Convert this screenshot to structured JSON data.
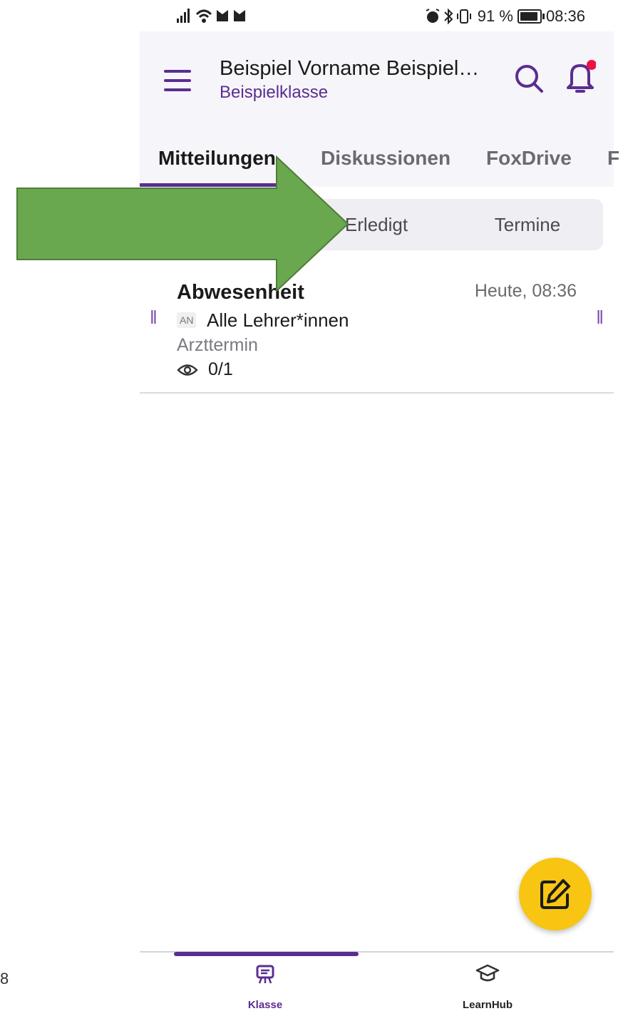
{
  "status_bar": {
    "left_icons": "signal wifi notification-icons",
    "battery_text": "91 %",
    "battery_level_percent": 91,
    "time": "08:36"
  },
  "header": {
    "title": "Beispiel Vorname Beispiel…",
    "subtitle": "Beispielklasse"
  },
  "tabs": [
    {
      "label": "Mitteilungen",
      "active": true
    },
    {
      "label": "Diskussionen",
      "active": false
    },
    {
      "label": "FoxDrive",
      "active": false
    },
    {
      "label": "F",
      "active": false
    }
  ],
  "filters": [
    {
      "label": "Erledigt"
    },
    {
      "label": "Termine"
    }
  ],
  "message": {
    "title": "Abwesenheit",
    "time": "Heute, 08:36",
    "badge": "AN",
    "recipient": "Alle Lehrer*innen",
    "preview": "Arzttermin",
    "read_count": "0/1",
    "handle_glyph": "‖"
  },
  "bottom_nav": [
    {
      "label": "Klasse",
      "icon": "easel-icon",
      "active": true
    },
    {
      "label": "LearnHub",
      "icon": "graduation-cap-icon",
      "active": false
    }
  ],
  "side_number": "8",
  "colors": {
    "brand_purple": "#5b2d90",
    "header_bg": "#f6f5fa",
    "fab_yellow": "#f7c512",
    "arrow_green": "#6aa84f",
    "notification_red": "#ee1144"
  }
}
